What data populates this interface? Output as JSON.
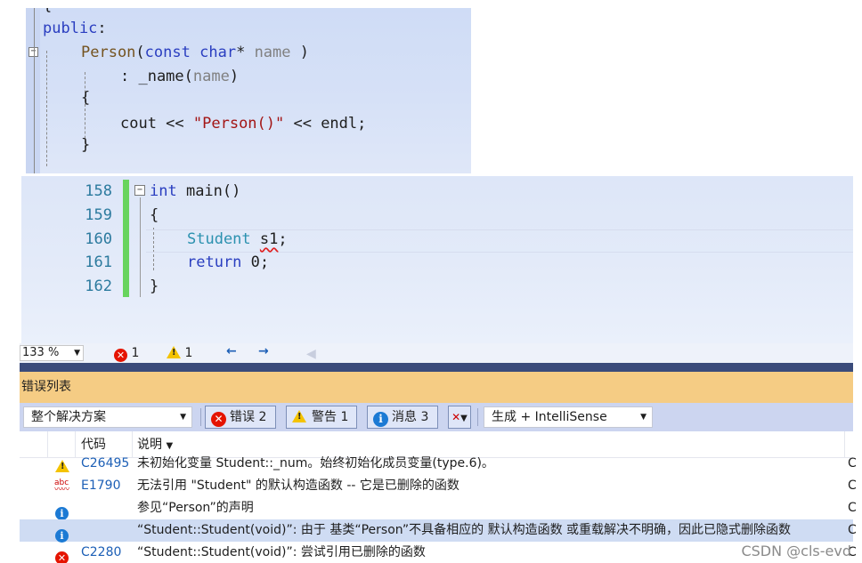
{
  "code_top": {
    "lines": {
      "l0": "{",
      "l1_kw": "public",
      "l1_p": ":",
      "l2_fn": "Person",
      "l2_p1": "(",
      "l2_kw1": "const",
      "l2_kw2": "char",
      "l2_star": "*",
      "l2_par": "name",
      "l2_p2": " )",
      "l3_a": ": _name",
      "l3_p": "(",
      "l3_par": "name",
      "l3_b": ")",
      "l4": "{",
      "l5_a": "cout << ",
      "l5_str": "\"Person()\"",
      "l5_b": " << endl;",
      "l6": "}"
    }
  },
  "code_main": {
    "line_numbers": [
      "158",
      "159",
      "160",
      "161",
      "162"
    ],
    "lines": {
      "l158_kw": "int",
      "l158_b": " main()",
      "l159": "{",
      "l160_ty": "Student",
      "l160_var": "s1",
      "l160_end": ";",
      "l161_kw": "return",
      "l161_b": " 0;",
      "l162": "}"
    }
  },
  "status_bar": {
    "zoom": "133 %",
    "error_count": "1",
    "warning_count": "1"
  },
  "error_list": {
    "title": "错误列表",
    "scope": "整个解决方案",
    "errors_btn": "错误 2",
    "warnings_btn": "警告 1",
    "messages_btn": "消息 3",
    "build_filter": "生成 + IntelliSense",
    "columns": {
      "code": "代码",
      "description": "说明"
    },
    "rows": [
      {
        "icon": "warning-icon",
        "code": "C26495",
        "description": "未初始化变量 Student::_num。始终初始化成员变量(type.6)。",
        "proj": "C"
      },
      {
        "icon": "intellisense-error-icon",
        "code": "E1790",
        "description": "无法引用 \"Student\" 的默认构造函数 -- 它是已删除的函数",
        "proj": "C"
      },
      {
        "icon": "info-icon",
        "code": "",
        "description": "参见“Person”的声明",
        "proj": "C"
      },
      {
        "icon": "info-icon",
        "code": "",
        "description": "“Student::Student(void)”: 由于 基类“Person”不具备相应的 默认构造函数 或重载解决不明确，因此已隐式删除函数",
        "proj": "C"
      },
      {
        "icon": "error-icon",
        "code": "C2280",
        "description": "“Student::Student(void)”: 尝试引用已删除的函数",
        "proj": "C"
      }
    ]
  },
  "watermark": "CSDN @cls-evd"
}
